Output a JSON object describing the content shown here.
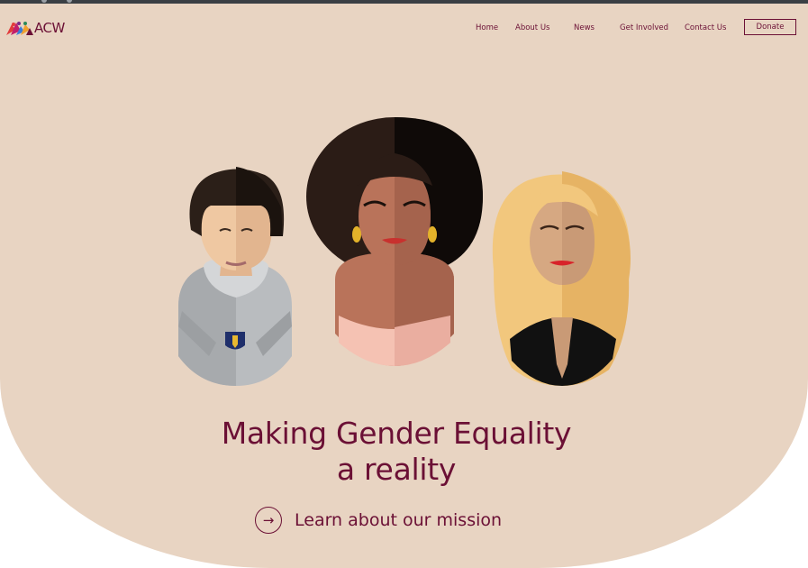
{
  "logo": {
    "text": "ACW",
    "icon": "acw-logo-icon"
  },
  "nav": {
    "items": [
      {
        "label": "Home"
      },
      {
        "label": "About Us"
      },
      {
        "label": "News"
      },
      {
        "label": "Get Involved"
      },
      {
        "label": "Contact Us"
      }
    ],
    "donate_label": "Donate"
  },
  "hero": {
    "headline_line1": "Making Gender Equality",
    "headline_line2": "a reality",
    "cta_label": "Learn about our mission",
    "cta_icon": "arrow-right-icon"
  },
  "colors": {
    "background": "#e8d4c2",
    "brand": "#6b1035"
  }
}
